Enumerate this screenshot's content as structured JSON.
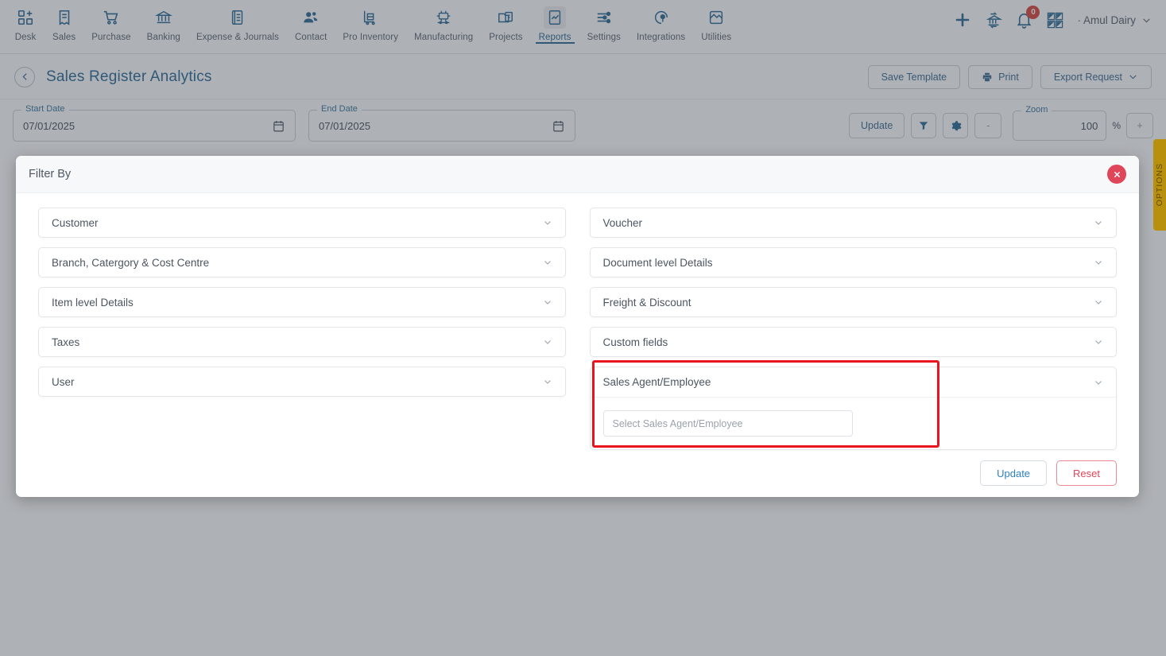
{
  "topnav": {
    "items": [
      {
        "label": "Desk",
        "icon": "desk-grid-plus-icon",
        "active": false
      },
      {
        "label": "Sales",
        "icon": "sales-receipt-icon",
        "active": false
      },
      {
        "label": "Purchase",
        "icon": "purchase-cart-icon",
        "active": false
      },
      {
        "label": "Banking",
        "icon": "banking-bank-icon",
        "active": false
      },
      {
        "label": "Expense & Journals",
        "icon": "expense-journal-icon",
        "active": false
      },
      {
        "label": "Contact",
        "icon": "contact-people-icon",
        "active": false
      },
      {
        "label": "Pro Inventory",
        "icon": "inventory-trolley-icon",
        "active": false
      },
      {
        "label": "Manufacturing",
        "icon": "manufacturing-gears-icon",
        "active": false
      },
      {
        "label": "Projects",
        "icon": "projects-folder-icon",
        "active": false
      },
      {
        "label": "Reports",
        "icon": "reports-chart-doc-icon",
        "active": true
      },
      {
        "label": "Settings",
        "icon": "settings-sliders-icon",
        "active": false
      },
      {
        "label": "Integrations",
        "icon": "integrations-plug-icon",
        "active": false
      },
      {
        "label": "Utilities",
        "icon": "utilities-puzzle-icon",
        "active": false
      }
    ],
    "right": {
      "add_icon": "plus-icon",
      "bank_transfer_icon": "bank-transfer-icon",
      "notification_icon": "bell-icon",
      "notification_count": "0",
      "apps_icon": "apps-grid-icon",
      "company_name": "· Amul Dairy",
      "company_chevron_icon": "chevron-down-icon"
    }
  },
  "pageheader": {
    "back_icon": "chevron-left-icon",
    "title": "Sales Register Analytics",
    "save_template_label": "Save Template",
    "print_label": "Print",
    "print_icon": "printer-icon",
    "export_label": "Export Request",
    "export_chevron_icon": "chevron-down-icon"
  },
  "toolbar": {
    "start_date_label": "Start Date",
    "start_date_value": "07/01/2025",
    "end_date_label": "End Date",
    "end_date_value": "07/01/2025",
    "calendar_icon": "calendar-icon",
    "update_label": "Update",
    "filter_icon": "funnel-filter-icon",
    "settings_icon": "gear-icon",
    "zoom_out_label": "-",
    "zoom_label": "Zoom",
    "zoom_value": "100",
    "percent_symbol": "%",
    "zoom_in_label": "+"
  },
  "options_tab": {
    "label": "OPTIONS",
    "color": "#b8900d"
  },
  "modal": {
    "title": "Filter By",
    "close_icon": "close-x-icon",
    "chevron_icon": "chevron-down-icon",
    "left_column": [
      {
        "label": "Customer"
      },
      {
        "label": "Branch, Catergory & Cost Centre"
      },
      {
        "label": "Item level Details"
      },
      {
        "label": "Taxes"
      },
      {
        "label": "User"
      }
    ],
    "right_column": [
      {
        "label": "Voucher"
      },
      {
        "label": "Document level Details"
      },
      {
        "label": "Freight & Discount"
      },
      {
        "label": "Custom fields"
      }
    ],
    "expanded_section": {
      "label": "Sales Agent/Employee",
      "select_placeholder": "Select Sales Agent/Employee"
    },
    "footer": {
      "update_label": "Update",
      "reset_label": "Reset"
    },
    "highlight_color": "#e8151f"
  }
}
